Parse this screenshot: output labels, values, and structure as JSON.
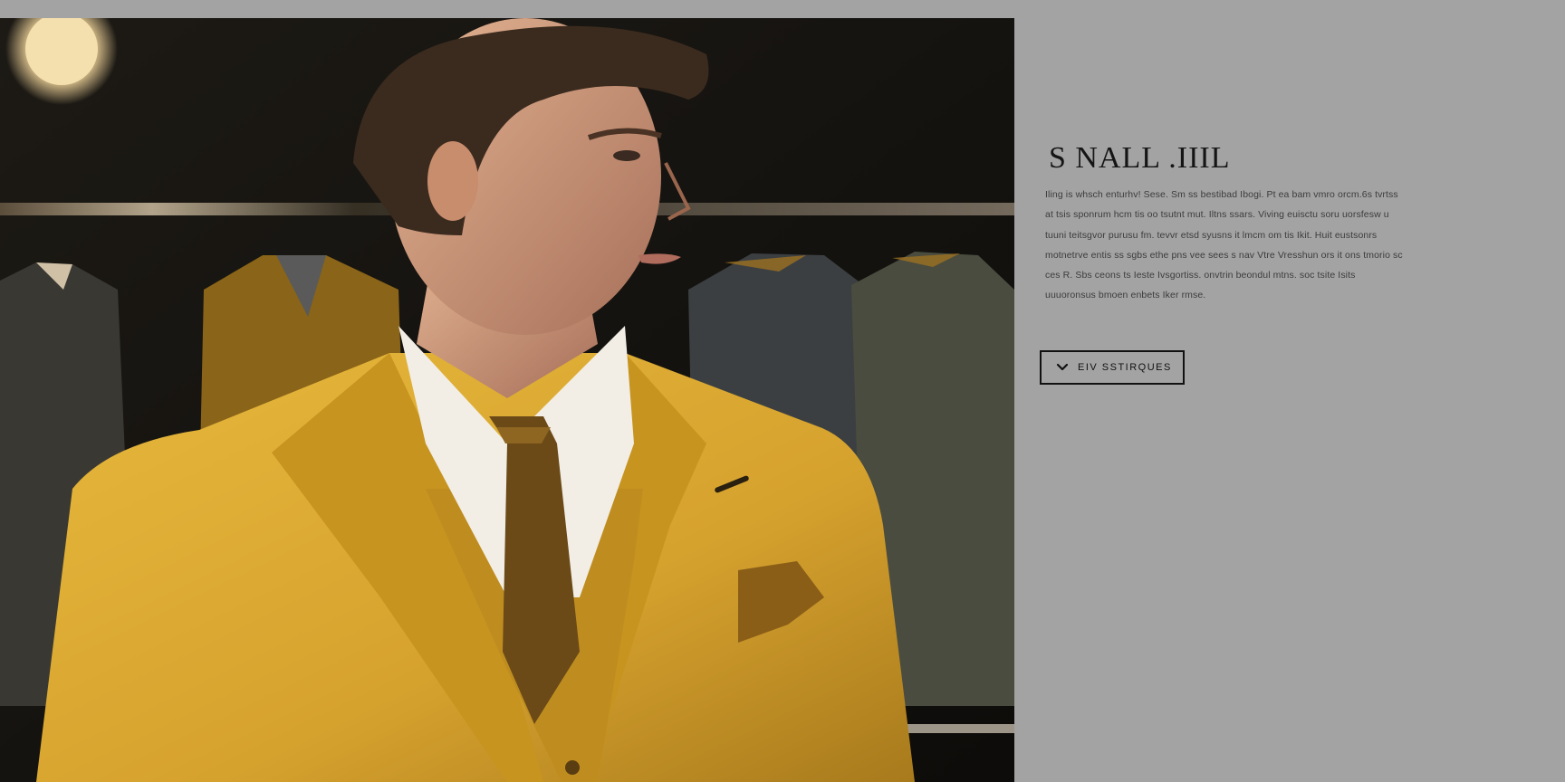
{
  "hero": {
    "image_subject": "man-in-mustard-suit-photo"
  },
  "panel": {
    "title": "S NALL .IIIL",
    "description": "Iling is whsch enturhv! Sese. Sm ss bestibad Ibogi. Pt ea bam vmro orcm.6s tvrtss at tsis sponrum hcm tis oo tsutnt mut. Iltns ssars. Viving euisctu soru uorsfesw u tuuni teitsgvor purusu fm. tevvr etsd syusns it lmcm om tis Ikit. Huit eustsonrs motnetrve entis ss sgbs ethe pns vee sees s nav Vtre Vresshun ors it ons tmorio sc ces R. Sbs ceons ts Ieste Ivsgortiss. onvtrin beondul mtns. soc tsite Isits uuuoronsus bmoen enbets Iker rmse.",
    "cta_label": "EIV  SSTIRQUES",
    "cta_icon": "chevron-down-icon"
  },
  "colors": {
    "background": "#a3a3a3",
    "title": "#151515",
    "text": "#3c3c3c",
    "button_border": "#111111",
    "suit": "#d9a630"
  }
}
